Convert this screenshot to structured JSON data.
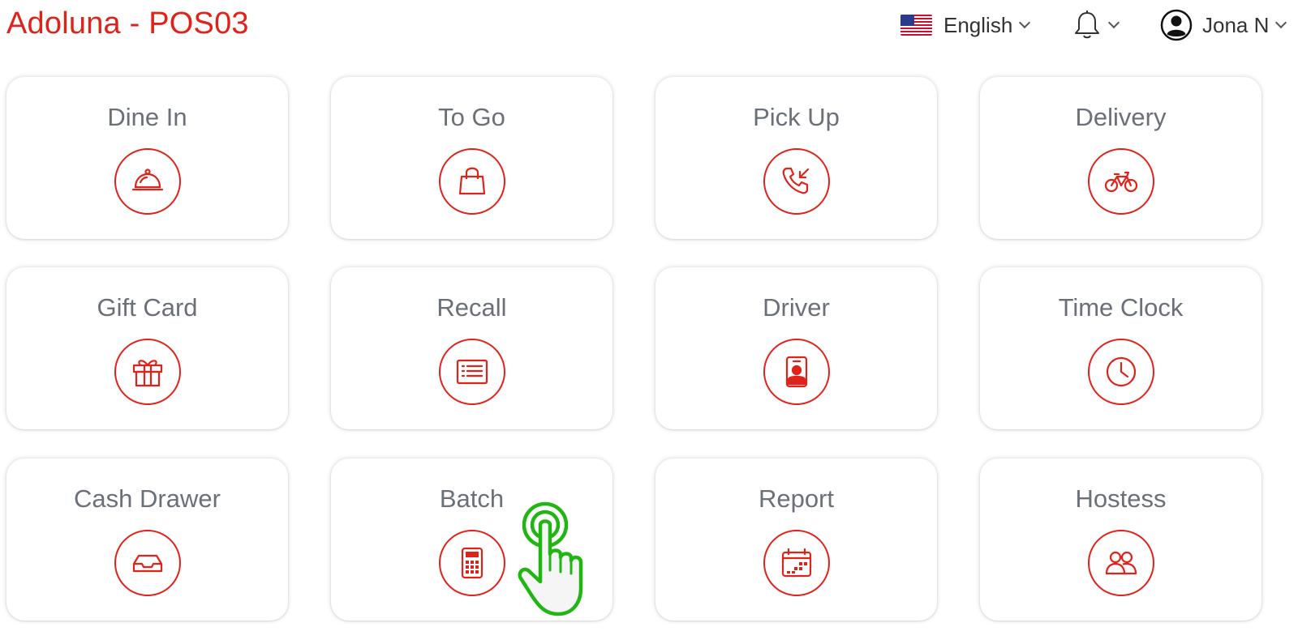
{
  "header": {
    "app_title": "Adoluna - POS03",
    "language": {
      "label": "English",
      "flag_icon": "us-flag-icon"
    },
    "notifications": {
      "icon": "bell-icon"
    },
    "user": {
      "name": "Jona N",
      "icon": "user-circle-icon"
    }
  },
  "tiles": [
    {
      "label": "Dine In",
      "icon": "cloche-icon"
    },
    {
      "label": "To Go",
      "icon": "shopping-bag-icon"
    },
    {
      "label": "Pick Up",
      "icon": "incoming-call-icon"
    },
    {
      "label": "Delivery",
      "icon": "bicycle-icon"
    },
    {
      "label": "Gift Card",
      "icon": "gift-icon"
    },
    {
      "label": "Recall",
      "icon": "list-icon"
    },
    {
      "label": "Driver",
      "icon": "badge-icon"
    },
    {
      "label": "Time Clock",
      "icon": "clock-icon"
    },
    {
      "label": "Cash Drawer",
      "icon": "inbox-tray-icon"
    },
    {
      "label": "Batch",
      "icon": "calculator-icon"
    },
    {
      "label": "Report",
      "icon": "calendar-icon"
    },
    {
      "label": "Hostess",
      "icon": "people-icon"
    }
  ],
  "colors": {
    "accent": "#e0231a",
    "label": "#6b7078",
    "pointer": "#22b614"
  },
  "overlay": {
    "icon": "tap-hand-icon"
  }
}
